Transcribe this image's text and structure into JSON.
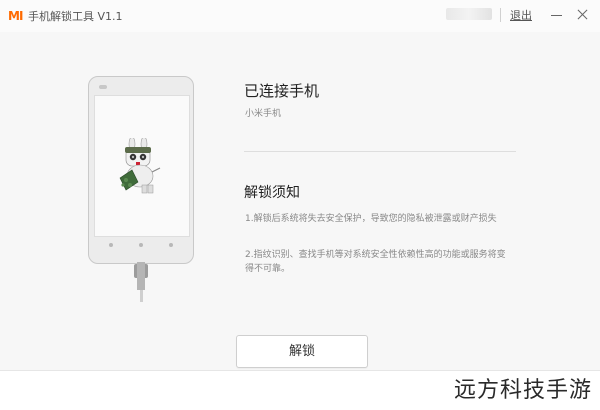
{
  "titlebar": {
    "logo_text": "MI",
    "app_title": "手机解锁工具  V1.1",
    "logout_label": "退出"
  },
  "main": {
    "connected_title": "已连接手机",
    "device_name": "小米手机",
    "notice_title": "解锁须知",
    "notices": [
      "1.解锁后系统将失去安全保护，导致您的隐私被泄露或财产损失",
      "2.指纹识别、查找手机等对系统安全性依赖性高的功能或服务将变得不可靠。"
    ],
    "unlock_label": "解锁"
  },
  "watermark": "远方科技手游",
  "colors": {
    "brand": "#ff6a00",
    "window_bg": "#f7f7f7",
    "text_primary": "#222222",
    "text_secondary": "#888888"
  },
  "icons": {
    "minimize": "minimize-icon",
    "close": "close-icon",
    "mascot": "mi-bunny-mascot-icon"
  }
}
